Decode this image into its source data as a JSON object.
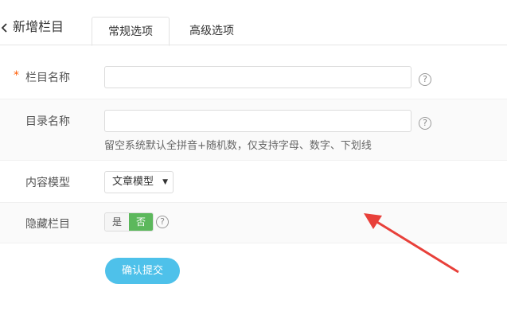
{
  "header": {
    "back_icon": "chevron-left-icon",
    "title": "新增栏目",
    "tabs": [
      {
        "label": "常规选项",
        "active": true
      },
      {
        "label": "高级选项",
        "active": false
      }
    ]
  },
  "form": {
    "name": {
      "required_mark": "*",
      "label": "栏目名称",
      "value": "",
      "help": "?"
    },
    "dir": {
      "label": "目录名称",
      "value": "",
      "help": "?",
      "hint": "留空系统默认全拼音+随机数，仅支持字母、数字、下划线"
    },
    "model": {
      "label": "内容模型",
      "selected": "文章模型"
    },
    "hidden": {
      "label": "隐藏栏目",
      "options": [
        "是",
        "否"
      ],
      "selected": "否",
      "help": "?"
    },
    "submit_label": "确认提交"
  },
  "colors": {
    "accent_submit": "#4ec1ea",
    "toggle_active": "#5cb85c",
    "annotation_arrow": "#e8403a",
    "required_star": "#ff5a00"
  }
}
